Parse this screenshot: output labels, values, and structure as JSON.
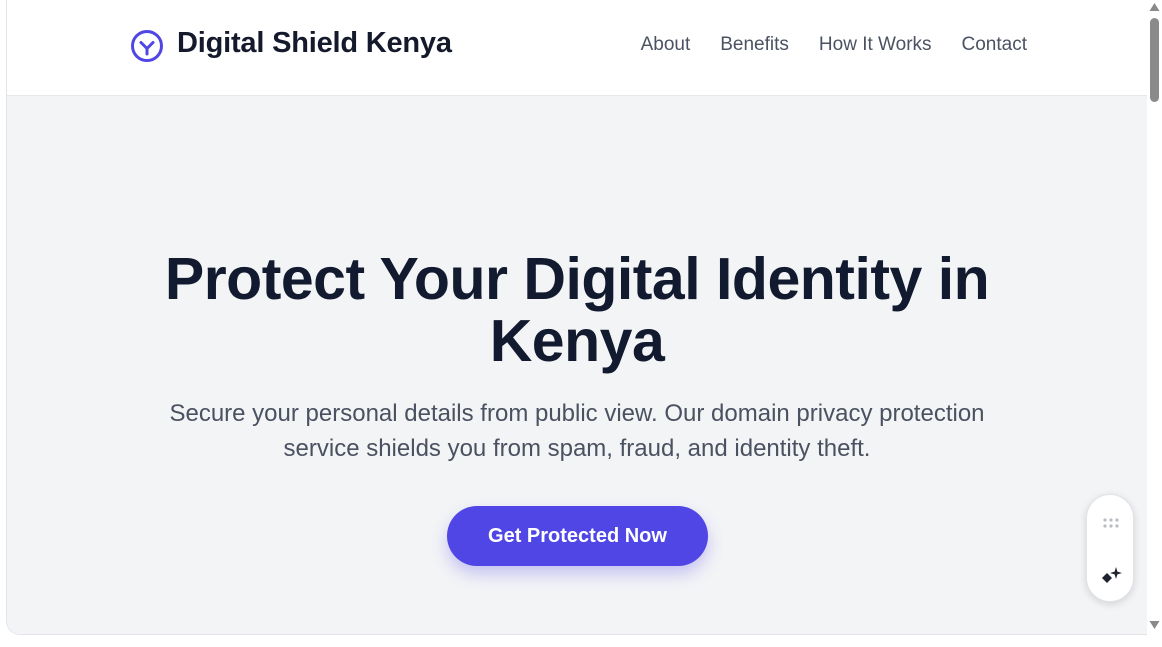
{
  "brand": {
    "name": "Digital Shield Kenya",
    "icon": "shield-check-icon",
    "accent_color": "#4f46e5"
  },
  "nav": {
    "links": [
      "About",
      "Benefits",
      "How It Works",
      "Contact"
    ]
  },
  "hero": {
    "title": "Protect Your Digital Identity in Kenya",
    "subtitle": "Secure your personal details from public view. Our domain privacy protection service shields you from spam, fraud, and identity theft.",
    "cta_label": "Get Protected Now",
    "background": "#f3f4f6"
  },
  "widget": {
    "icons": [
      "grip-dots-icon",
      "sparkle-icon"
    ]
  }
}
